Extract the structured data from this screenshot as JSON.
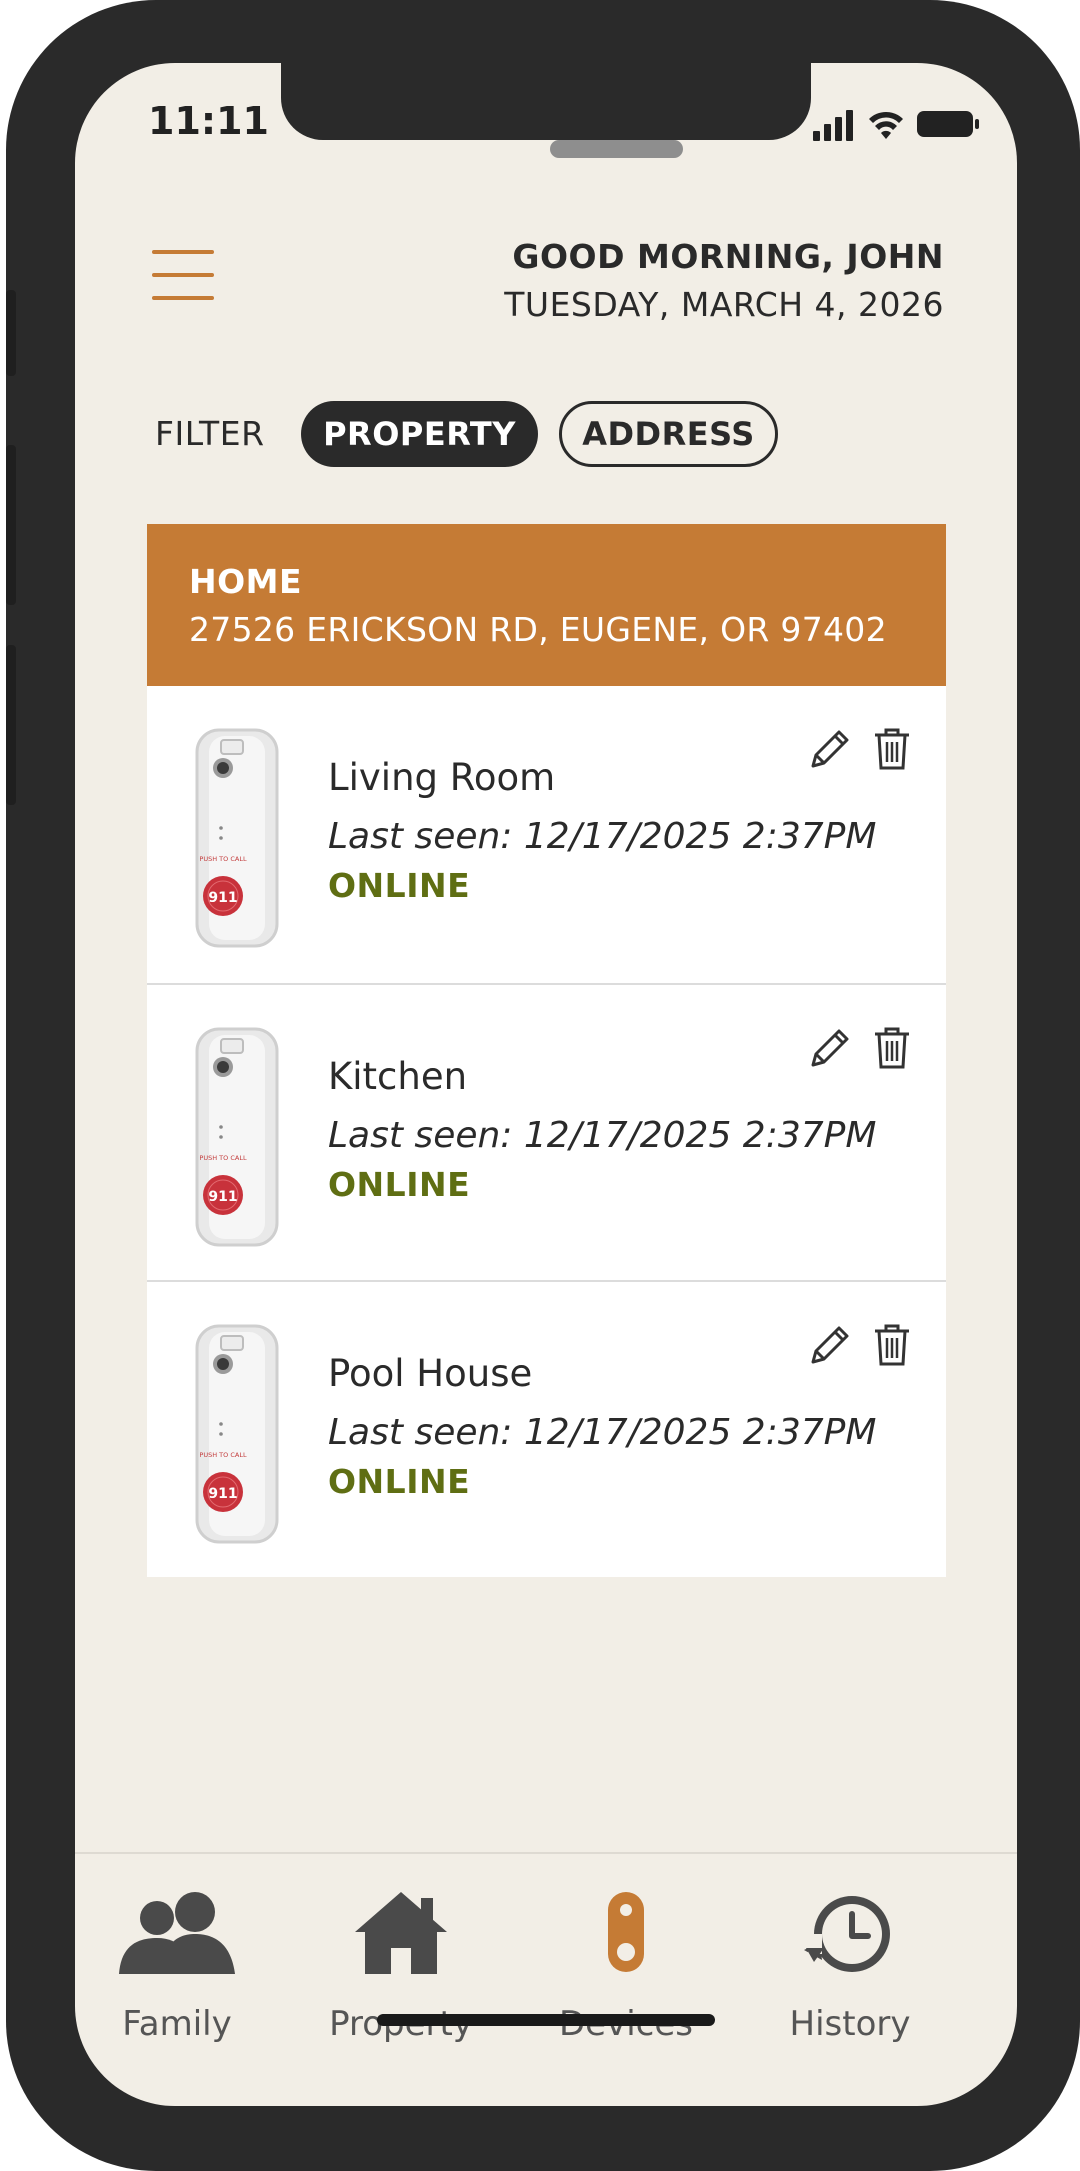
{
  "status_bar": {
    "time": "11:11"
  },
  "header": {
    "greeting": "GOOD MORNING, JOHN",
    "date": "TUESDAY, MARCH 4, 2026"
  },
  "filter": {
    "label": "FILTER",
    "options": [
      {
        "label": "PROPERTY",
        "selected": true
      },
      {
        "label": "ADDRESS",
        "selected": false
      }
    ]
  },
  "property": {
    "name": "HOME",
    "address": "27526 ERICKSON RD, EUGENE, OR 97402"
  },
  "devices": [
    {
      "name": "Living Room",
      "last_seen": "Last seen: 12/17/2025 2:37PM",
      "status": "ONLINE",
      "button_text": "911"
    },
    {
      "name": "Kitchen",
      "last_seen": "Last seen: 12/17/2025 2:37PM",
      "status": "ONLINE",
      "button_text": "911"
    },
    {
      "name": "Pool House",
      "last_seen": "Last seen: 12/17/2025 2:37PM",
      "status": "ONLINE",
      "button_text": "911"
    }
  ],
  "bottom_nav": [
    {
      "label": "Family",
      "icon": "family-icon"
    },
    {
      "label": "Property",
      "icon": "house-icon"
    },
    {
      "label": "Devices",
      "icon": "device-icon",
      "active": true
    },
    {
      "label": "History",
      "icon": "history-icon"
    }
  ],
  "colors": {
    "accent": "#c57b35",
    "online": "#5f6e13",
    "background": "#f2eee6",
    "dark": "#2a2a2a"
  }
}
